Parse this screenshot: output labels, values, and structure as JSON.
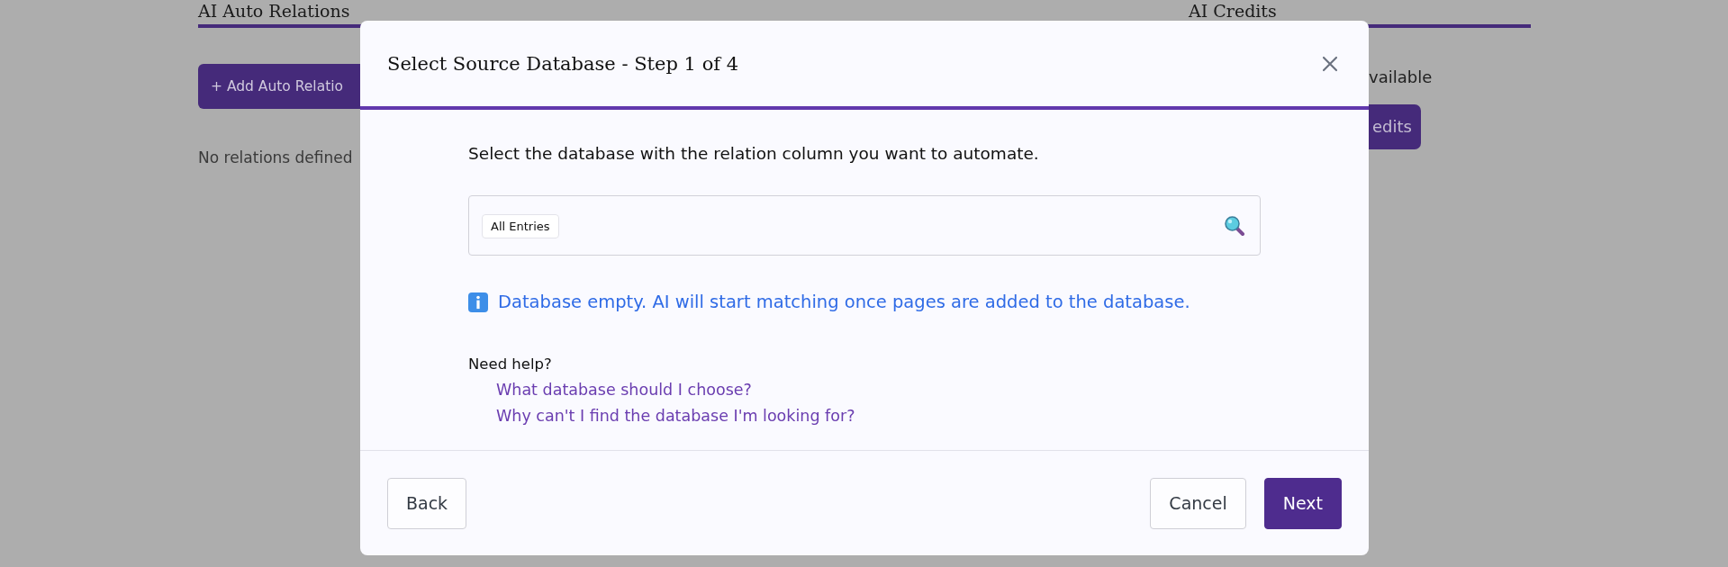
{
  "background": {
    "left": {
      "heading": "AI Auto Relations",
      "button": "+ Add Auto Relatio",
      "empty_text": "No relations defined"
    },
    "right": {
      "heading": "AI Credits",
      "available_text": "vailable",
      "button": "edits"
    }
  },
  "dialog": {
    "title": "Select Source Database - Step 1 of 4",
    "instruction": "Select the database with the relation column you want to automate.",
    "search": {
      "chips": [
        "All Entries"
      ]
    },
    "info": "Database empty. AI will start matching once pages are added to the database.",
    "help": {
      "heading": "Need help?",
      "links": [
        "What database should I choose?",
        "Why can't I find the database I'm looking for?"
      ]
    },
    "footer": {
      "left_buttons": [
        {
          "label": "Back",
          "kind": "secondary"
        }
      ],
      "right_buttons": [
        {
          "label": "Cancel",
          "kind": "secondary"
        },
        {
          "label": "Next",
          "kind": "primary"
        }
      ]
    }
  }
}
